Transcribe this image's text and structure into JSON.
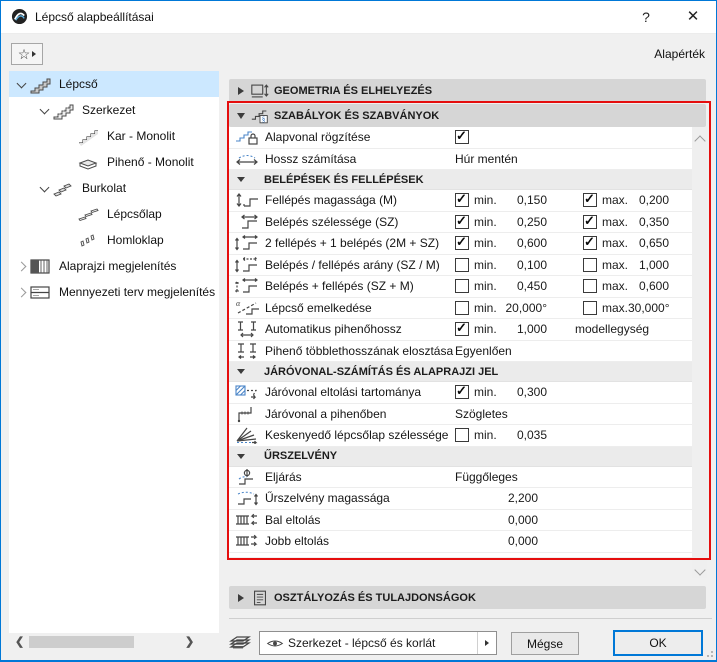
{
  "window": {
    "title": "Lépcső alapbeállításai",
    "help_glyph": "?",
    "close_glyph": "✕"
  },
  "toolbar": {
    "favorites_star": "☆",
    "default_label": "Alapérték"
  },
  "tree": {
    "items": [
      {
        "label": "Lépcső",
        "level": 0,
        "state": "expanded",
        "selected": true
      },
      {
        "label": "Szerkezet",
        "level": 1,
        "state": "expanded"
      },
      {
        "label": "Kar - Monolit",
        "level": 2
      },
      {
        "label": "Pihenő - Monolit",
        "level": 2
      },
      {
        "label": "Burkolat",
        "level": 1,
        "state": "expanded"
      },
      {
        "label": "Lépcsőlap",
        "level": 2
      },
      {
        "label": "Homloklap",
        "level": 2
      },
      {
        "label": "Alaprajzi megjelenítés",
        "level": 0,
        "state": "collapsed"
      },
      {
        "label": "Mennyezeti terv megjelenítés",
        "level": 0,
        "state": "collapsed"
      }
    ]
  },
  "sections": {
    "geometry": "GEOMETRIA ÉS ELHELYEZÉS",
    "rules": "SZABÁLYOK ÉS SZABVÁNYOK",
    "classification": "OSZTÁLYOZÁS ÉS TULAJDONSÁGOK"
  },
  "rules": {
    "min_label": "min.",
    "max_label": "max.",
    "sub_steps": "BELÉPÉSEK ÉS FELLÉPÉSEK",
    "sub_walkline": "JÁRÓVONAL-SZÁMÍTÁS ÉS ALAPRAJZI JEL",
    "sub_headroom": "ŰRSZELVÉNY",
    "r0": {
      "label": "Alapvonal rögzítése",
      "checked": true
    },
    "r1": {
      "label": "Hossz számítása",
      "value": "Húr mentén"
    },
    "r2": {
      "label": "Fellépés magassága (M)",
      "min_checked": true,
      "min": "0,150",
      "max_checked": true,
      "max": "0,200"
    },
    "r3": {
      "label": "Belépés szélessége (SZ)",
      "min_checked": true,
      "min": "0,250",
      "max_checked": true,
      "max": "0,350"
    },
    "r4": {
      "label": "2 fellépés + 1 belépés (2M + SZ)",
      "min_checked": true,
      "min": "0,600",
      "max_checked": true,
      "max": "0,650"
    },
    "r5": {
      "label": "Belépés / fellépés arány (SZ / M)",
      "min_checked": false,
      "min": "0,100",
      "max_checked": false,
      "max": "1,000"
    },
    "r6": {
      "label": "Belépés + fellépés (SZ + M)",
      "min_checked": false,
      "min": "0,450",
      "max_checked": false,
      "max": "0,600"
    },
    "r7": {
      "label": "Lépcső emelkedése",
      "min_checked": false,
      "min": "20,000°",
      "max_checked": false,
      "max": "30,000°"
    },
    "r8": {
      "label": "Automatikus pihenőhossz",
      "min_checked": true,
      "min": "1,000",
      "unit": "modellegység"
    },
    "r9": {
      "label": "Pihenő többlethosszának elosztása",
      "value": "Egyenlően"
    },
    "r10": {
      "label": "Járóvonal eltolási tartománya",
      "min_checked": true,
      "min": "0,300"
    },
    "r11": {
      "label": "Járóvonal a pihenőben",
      "value": "Szögletes"
    },
    "r12": {
      "label": "Keskenyedő lépcsőlap szélessége",
      "min_checked": false,
      "min": "0,035"
    },
    "r13": {
      "label": "Eljárás",
      "value": "Függőleges"
    },
    "r14": {
      "label": "Űrszelvény magassága",
      "value": "2,200"
    },
    "r15": {
      "label": "Bal eltolás",
      "value": "0,000"
    },
    "r16": {
      "label": "Jobb eltolás",
      "value": "0,000"
    }
  },
  "footer": {
    "layer_value": "Szerkezet - lépcső és korlát",
    "cancel_label": "Mégse",
    "ok_label": "OK"
  },
  "colors": {
    "window_border": "#0078d7",
    "selection": "#cce8ff",
    "highlight_red": "#e50e0e",
    "ok_border": "#0078d7"
  }
}
